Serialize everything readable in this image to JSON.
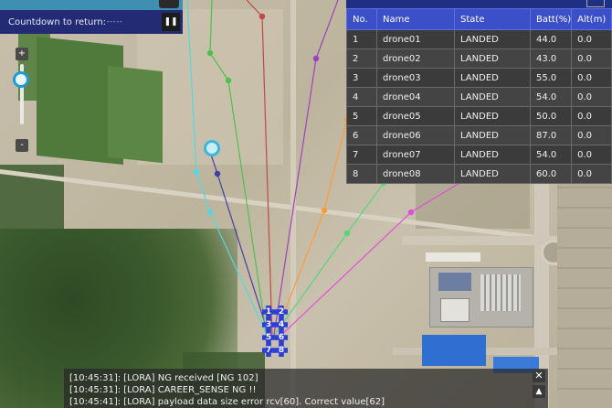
{
  "top_bar": {
    "countdown_label": "Countdown to return:",
    "countdown_value": "-----",
    "pause_icon": "pause-icon"
  },
  "zoom": {
    "plus_label": "+",
    "minus_label": "-",
    "level_fraction": 0.12
  },
  "drone_table": {
    "headers": [
      "No.",
      "Name",
      "State",
      "Batt(%)",
      "Alt(m)"
    ],
    "rows": [
      {
        "no": "1",
        "name": "drone01",
        "state": "LANDED",
        "batt": "44.0",
        "alt": "0.0"
      },
      {
        "no": "2",
        "name": "drone02",
        "state": "LANDED",
        "batt": "43.0",
        "alt": "0.0"
      },
      {
        "no": "3",
        "name": "drone03",
        "state": "LANDED",
        "batt": "55.0",
        "alt": "0.0"
      },
      {
        "no": "4",
        "name": "drone04",
        "state": "LANDED",
        "batt": "54.0",
        "alt": "0.0"
      },
      {
        "no": "5",
        "name": "drone05",
        "state": "LANDED",
        "batt": "50.0",
        "alt": "0.0"
      },
      {
        "no": "6",
        "name": "drone06",
        "state": "LANDED",
        "batt": "87.0",
        "alt": "0.0"
      },
      {
        "no": "7",
        "name": "drone07",
        "state": "LANDED",
        "batt": "54.0",
        "alt": "0.0"
      },
      {
        "no": "8",
        "name": "drone08",
        "state": "LANDED",
        "batt": "60.0",
        "alt": "0.0"
      }
    ]
  },
  "drone_markers": [
    "1",
    "2",
    "3",
    "4",
    "5",
    "6",
    "7",
    "8"
  ],
  "routes": [
    {
      "drone": "drone01",
      "color": "#ff9a3c"
    },
    {
      "drone": "drone02",
      "color": "#56d67a"
    },
    {
      "drone": "drone03",
      "color": "#e04fd6"
    },
    {
      "drone": "drone04",
      "color": "#57d6e0"
    },
    {
      "drone": "drone05",
      "color": "#3f3fa8"
    },
    {
      "drone": "drone06",
      "color": "#4ec04e"
    },
    {
      "drone": "drone07",
      "color": "#c04848"
    },
    {
      "drone": "drone08",
      "color": "#a040c0"
    }
  ],
  "log": {
    "lines": [
      "[10:45:31]: [LORA] NG received [NG 102]",
      "[10:45:31]: [LORA] CAREER_SENSE NG !!",
      "[10:45:41]: [LORA] payload data size error rcv[60]. Correct value[62]"
    ],
    "close_icon": "close-icon",
    "scroll_up_icon": "triangle-up-icon"
  }
}
